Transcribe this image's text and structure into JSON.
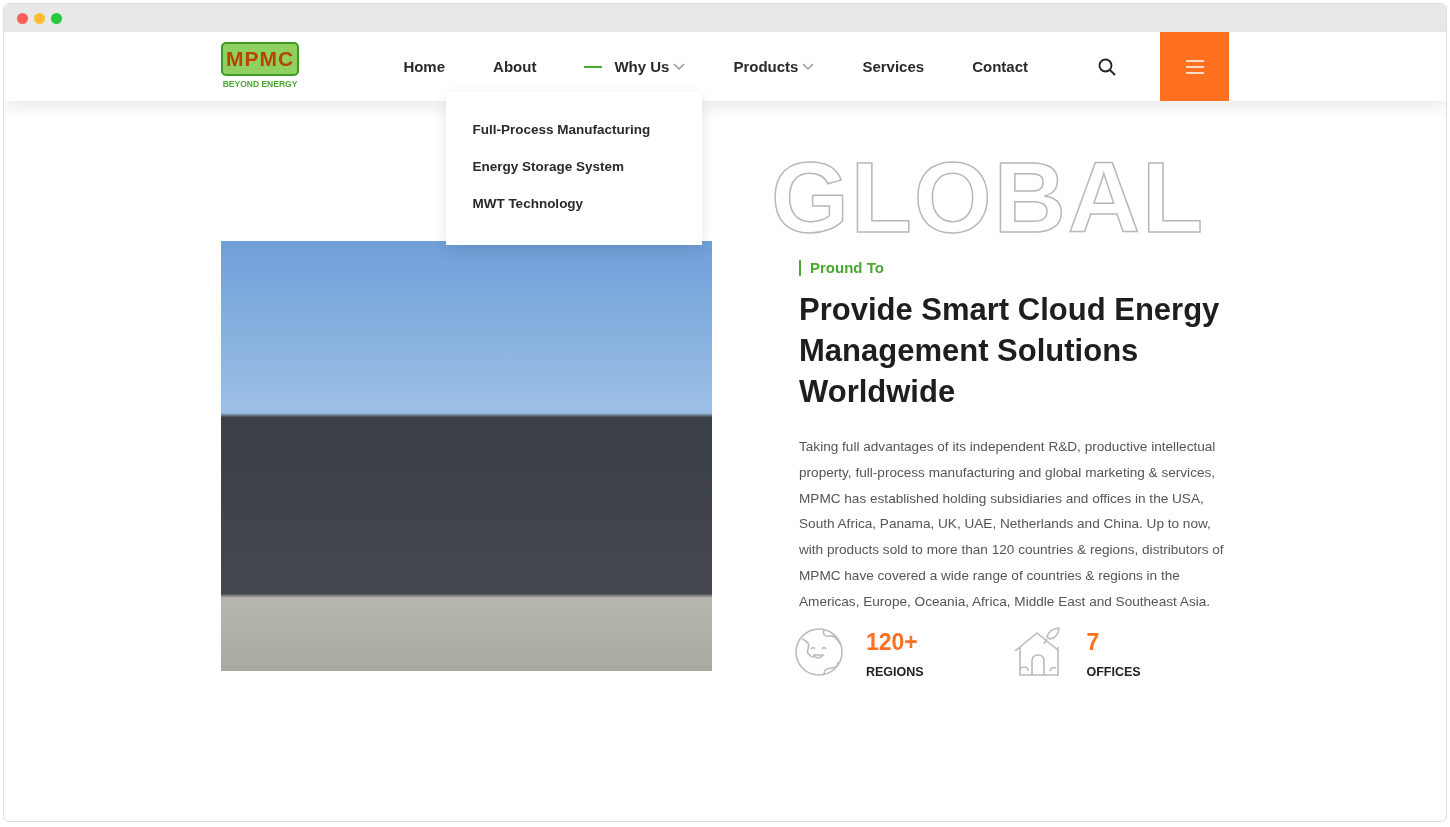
{
  "logo": {
    "mark": "MPMC",
    "tagline": "BEYOND ENERGY"
  },
  "nav": [
    {
      "label": "Home",
      "kind": "link",
      "selected": false
    },
    {
      "label": "About",
      "kind": "link",
      "selected": false
    },
    {
      "label": "Why Us",
      "kind": "dropdown",
      "selected": true,
      "expanded": true,
      "children": [
        "Full-Process Manufacturing",
        "Energy Storage System",
        "MWT Technology"
      ]
    },
    {
      "label": "Products",
      "kind": "dropdown",
      "selected": false,
      "expanded": false
    },
    {
      "label": "Services",
      "kind": "link",
      "selected": false
    },
    {
      "label": "Contact",
      "kind": "link",
      "selected": false
    }
  ],
  "about": {
    "background_word": "GLOBAL",
    "eyebrow": "Pround To",
    "heading": "Provide Smart Cloud Energy Management Solutions Worldwide",
    "body": "Taking full advantages of its independent R&D, productive intellectual property, full-process manufacturing and global marketing & services, MPMC has established holding subsidiaries and offices in the USA, South Africa, Panama, UK, UAE, Netherlands and China. Up to now, with products sold to more than 120 countries & regions, distributors of MPMC have covered a wide range of countries & regions in the Americas, Europe, Oceania, Africa, Middle East and Southeast Asia.",
    "stats": [
      {
        "kind": "globe",
        "value": "120+",
        "label": "REGIONS"
      },
      {
        "kind": "house",
        "value": "7",
        "label": "OFFICES"
      }
    ]
  }
}
